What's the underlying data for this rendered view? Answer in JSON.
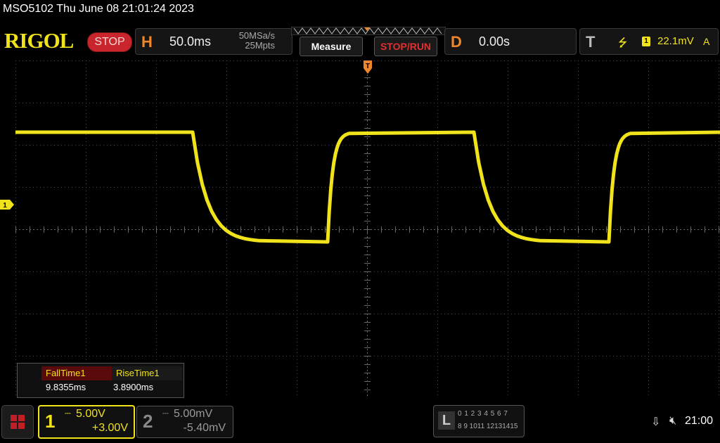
{
  "title": "MSO5102  Thu June 08 21:01:24 2023",
  "header": {
    "logo": "RIGOL",
    "run_state": "STOP",
    "horizontal": {
      "letter": "H",
      "timebase": "50.0ms",
      "sample_rate": "50MSa/s",
      "memory_depth": "25Mpts"
    },
    "measure_label": "Measure",
    "stop_run_label": "STOP/RUN",
    "delay": {
      "letter": "D",
      "value": "0.00s"
    },
    "trigger": {
      "letter": "T",
      "edge_icon": "rising-edge-icon",
      "source": "1",
      "level": "22.1mV",
      "mode": "A"
    }
  },
  "waveform": {
    "color": "#f0e31b",
    "high_level_div": 2.3,
    "low_level_div": -0.3,
    "period_ms": 200,
    "fall_time_ms": 9.8355,
    "rise_time_ms": 3.89,
    "fall_edges_ms": [
      -124,
      76
    ],
    "rise_edges_ms": [
      -28,
      172
    ]
  },
  "markers": {
    "ch1_label": "1",
    "trigger_pos_label": "T"
  },
  "measurements": [
    {
      "label": "FallTime1",
      "value": "9.8355ms"
    },
    {
      "label": "RiseTime1",
      "value": "3.8900ms"
    }
  ],
  "channels": [
    {
      "number": "1",
      "coupling_icon": "dc-coupling-icon",
      "scale": "5.00V",
      "offset": "+3.00V",
      "color": "#f0e31b"
    },
    {
      "number": "2",
      "coupling_icon": "dc-coupling-icon",
      "scale": "5.00mV",
      "offset": "-5.40mV",
      "color": "#888888"
    }
  ],
  "logic": {
    "letter": "L",
    "row1": "0 1 2 3   4 5 6 7",
    "row2": "8  9 1011 12131415"
  },
  "status": {
    "usb_icon": "usb-icon",
    "sound_icon": "sound-muted-icon",
    "time": "21:00"
  },
  "colors": {
    "accent_orange": "#f0862c",
    "stop_red": "#c8262c",
    "trace_yellow": "#f0e31b"
  }
}
